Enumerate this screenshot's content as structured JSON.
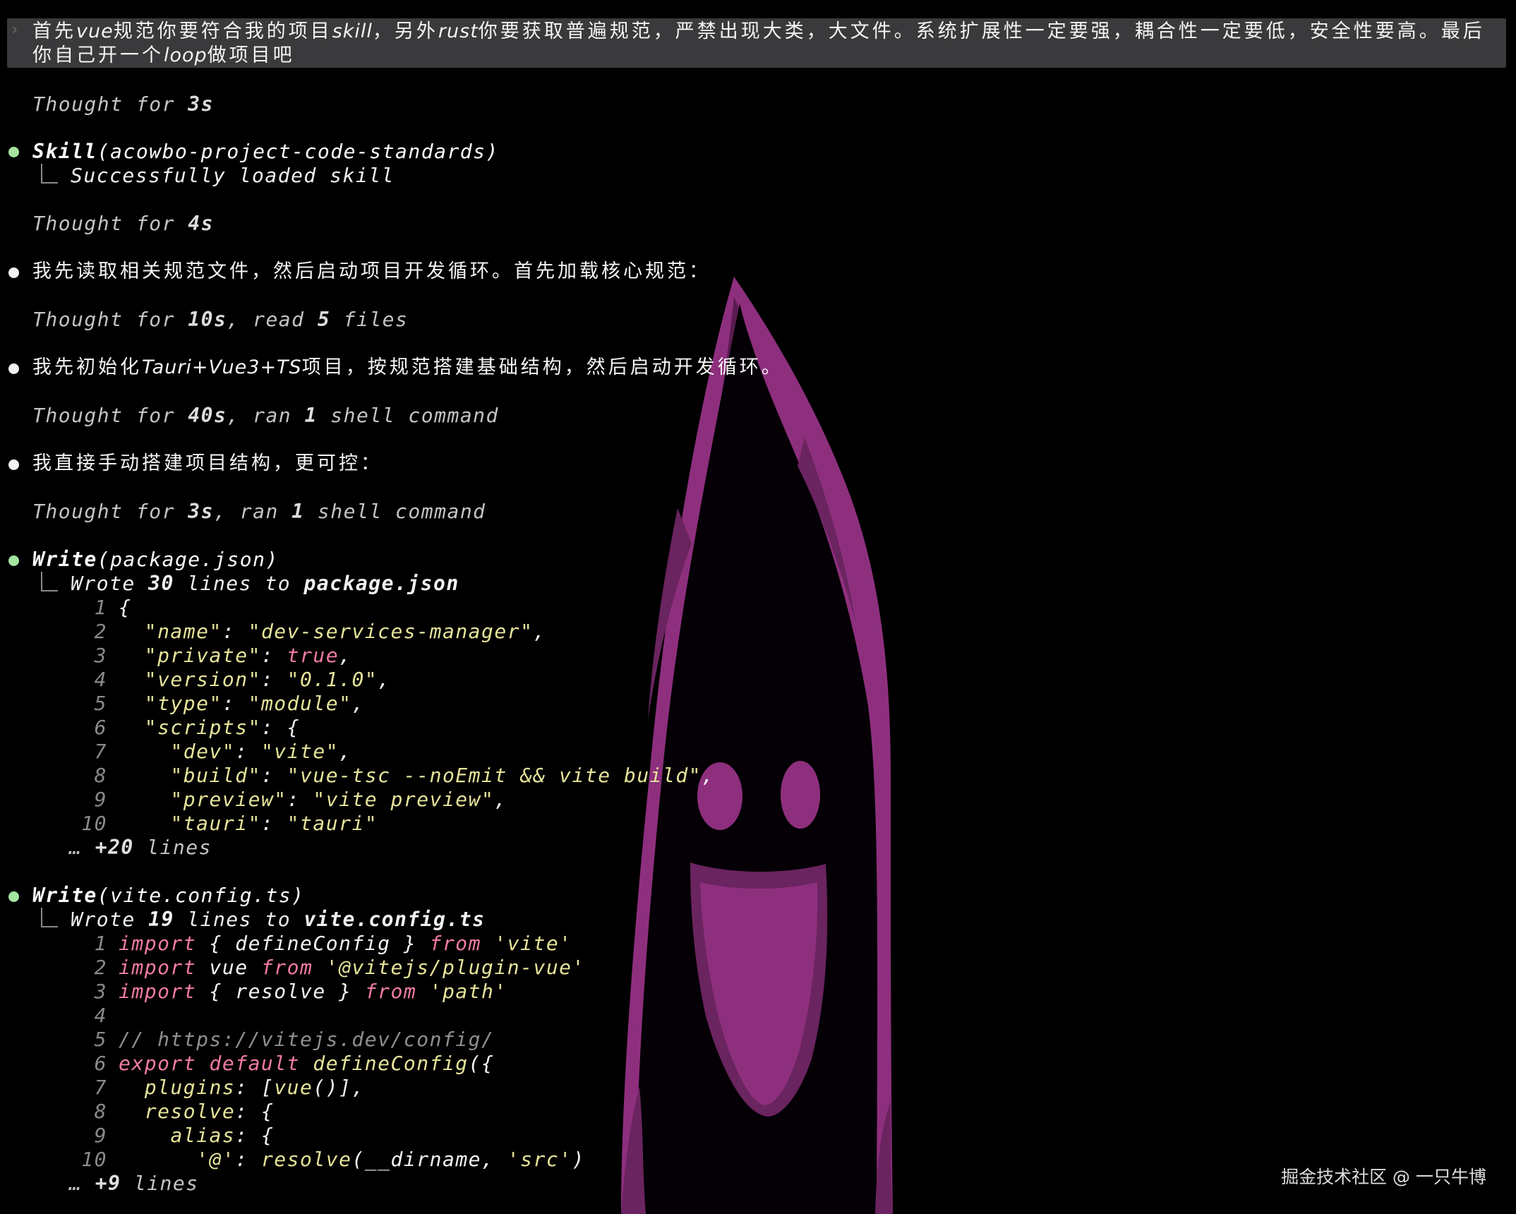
{
  "prompt": {
    "parts": [
      "首先",
      "vue",
      "规范你要符合我的项目",
      "skill",
      "，另外",
      "rust",
      "你要获取普遍规范，严禁出现大类，大文件。系统扩展性一定要强，耦合性一定要低，安全性要高。最后你自己开一个",
      "loop",
      "做项目吧"
    ]
  },
  "thoughts": [
    {
      "prefix": "Thought for ",
      "value": "3s",
      "rest": ""
    },
    {
      "prefix": "Thought for ",
      "value": "4s",
      "rest": ""
    },
    {
      "prefix": "Thought for ",
      "value": "10s",
      "rest": ", read ",
      "count": "5",
      "tail": " files"
    },
    {
      "prefix": "Thought for ",
      "value": "40s",
      "rest": ", ran ",
      "count": "1",
      "tail": " shell command"
    },
    {
      "prefix": "Thought for ",
      "value": "3s",
      "rest": ", ran ",
      "count": "1",
      "tail": " shell command"
    }
  ],
  "skill_call": {
    "name": "Skill",
    "arg": "(acowbo-project-code-standards)",
    "result": "Successfully loaded skill"
  },
  "messages": [
    {
      "text": "我先读取相关规范文件，然后启动项目开发循环。首先加载核心规范："
    },
    {
      "pre": "我先初始化",
      "code": "Tauri+Vue3+TS",
      "post": "项目，按规范搭建基础结构，然后启动开发循环。"
    },
    {
      "text": "我直接手动搭建项目结构，更可控："
    }
  ],
  "write1": {
    "name": "Write",
    "arg": "(package.json)",
    "result_pre": "Wrote ",
    "count": "30",
    "result_mid": " lines to ",
    "file": "package.json",
    "lines": [
      {
        "n": "1",
        "t": "{"
      },
      {
        "n": "2",
        "t": "  \"name\": \"dev-services-manager\","
      },
      {
        "n": "3",
        "t": "  \"private\": true,"
      },
      {
        "n": "4",
        "t": "  \"version\": \"0.1.0\","
      },
      {
        "n": "5",
        "t": "  \"type\": \"module\","
      },
      {
        "n": "6",
        "t": "  \"scripts\": {"
      },
      {
        "n": "7",
        "t": "    \"dev\": \"vite\","
      },
      {
        "n": "8",
        "t": "    \"build\": \"vue-tsc --noEmit && vite build\","
      },
      {
        "n": "9",
        "t": "    \"preview\": \"vite preview\","
      },
      {
        "n": "10",
        "t": "    \"tauri\": \"tauri\""
      }
    ],
    "more_prefix": "… ",
    "more": "+20",
    "more_suffix": " lines"
  },
  "write2": {
    "name": "Write",
    "arg": "(vite.config.ts)",
    "result_pre": "Wrote ",
    "count": "19",
    "result_mid": " lines to ",
    "file": "vite.config.ts",
    "lines": [
      {
        "n": "1",
        "t": "import { defineConfig } from 'vite'"
      },
      {
        "n": "2",
        "t": "import vue from '@vitejs/plugin-vue'"
      },
      {
        "n": "3",
        "t": "import { resolve } from 'path'"
      },
      {
        "n": "4",
        "t": ""
      },
      {
        "n": "5",
        "t": "// https://vitejs.dev/config/"
      },
      {
        "n": "6",
        "t": "export default defineConfig({"
      },
      {
        "n": "7",
        "t": "  plugins: [vue()],"
      },
      {
        "n": "8",
        "t": "  resolve: {"
      },
      {
        "n": "9",
        "t": "    alias: {"
      },
      {
        "n": "10",
        "t": "      '@': resolve(__dirname, 'src')"
      }
    ],
    "more_prefix": "… ",
    "more": "+9",
    "more_suffix": " lines"
  },
  "watermark": "掘金技术社区 @ 一只牛博",
  "colors": {
    "background": "#000000",
    "prompt_bg": "#3a3a3c",
    "bullet_green": "#a6e3a1",
    "string": "#e6e39a",
    "keyword": "#f07c9f",
    "art": "#8e2f7e"
  },
  "icons": {
    "prompt": "chevron-right-icon",
    "tree": "tree-branch-icon",
    "background": "ghost-figure-icon"
  }
}
